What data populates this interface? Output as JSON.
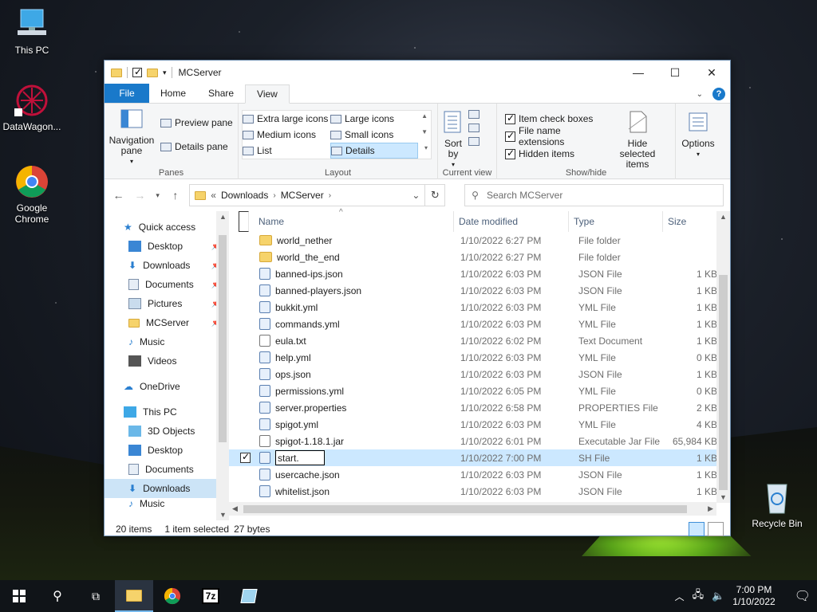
{
  "desktop": {
    "icons": [
      {
        "label": "This PC"
      },
      {
        "label": "DataWagon..."
      },
      {
        "label": "Google Chrome"
      },
      {
        "label": "Recycle Bin"
      }
    ]
  },
  "window": {
    "title": "MCServer",
    "menu_tabs": [
      "File",
      "Home",
      "Share",
      "View"
    ],
    "ribbon": {
      "panes": {
        "navigation_pane": "Navigation pane",
        "preview_pane": "Preview pane",
        "details_pane": "Details pane",
        "label": "Panes"
      },
      "layout": {
        "items": [
          "Extra large icons",
          "Large icons",
          "Medium icons",
          "Small icons",
          "List",
          "Details"
        ],
        "label": "Layout"
      },
      "current_view": {
        "sort_by": "Sort by",
        "label": "Current view"
      },
      "show_hide": {
        "item_check_boxes": "Item check boxes",
        "file_name_extensions": "File name extensions",
        "hidden_items": "Hidden items",
        "hide_selected_items": "Hide selected items",
        "label": "Show/hide"
      },
      "options": "Options"
    },
    "address": {
      "prefix": "«",
      "crumbs": [
        "Downloads",
        "MCServer"
      ],
      "search_placeholder": "Search MCServer"
    },
    "nav_pane": {
      "quick_access": "Quick access",
      "quick_items": [
        "Desktop",
        "Downloads",
        "Documents",
        "Pictures",
        "MCServer",
        "Music",
        "Videos"
      ],
      "onedrive": "OneDrive",
      "this_pc": "This PC",
      "pc_items": [
        "3D Objects",
        "Desktop",
        "Documents",
        "Downloads",
        "Music"
      ]
    },
    "columns": [
      "Name",
      "Date modified",
      "Type",
      "Size"
    ],
    "files": [
      {
        "name": "world_nether",
        "date": "1/10/2022 6:27 PM",
        "type": "File folder",
        "size": "",
        "icon": "folder-icon"
      },
      {
        "name": "world_the_end",
        "date": "1/10/2022 6:27 PM",
        "type": "File folder",
        "size": "",
        "icon": "folder-icon"
      },
      {
        "name": "banned-ips.json",
        "date": "1/10/2022 6:03 PM",
        "type": "JSON File",
        "size": "1 KB",
        "icon": "file-icon"
      },
      {
        "name": "banned-players.json",
        "date": "1/10/2022 6:03 PM",
        "type": "JSON File",
        "size": "1 KB",
        "icon": "file-icon"
      },
      {
        "name": "bukkit.yml",
        "date": "1/10/2022 6:03 PM",
        "type": "YML File",
        "size": "1 KB",
        "icon": "file-icon"
      },
      {
        "name": "commands.yml",
        "date": "1/10/2022 6:03 PM",
        "type": "YML File",
        "size": "1 KB",
        "icon": "file-icon"
      },
      {
        "name": "eula.txt",
        "date": "1/10/2022 6:02 PM",
        "type": "Text Document",
        "size": "1 KB",
        "icon": "text-file-icon"
      },
      {
        "name": "help.yml",
        "date": "1/10/2022 6:03 PM",
        "type": "YML File",
        "size": "0 KB",
        "icon": "file-icon"
      },
      {
        "name": "ops.json",
        "date": "1/10/2022 6:03 PM",
        "type": "JSON File",
        "size": "1 KB",
        "icon": "file-icon"
      },
      {
        "name": "permissions.yml",
        "date": "1/10/2022 6:05 PM",
        "type": "YML File",
        "size": "0 KB",
        "icon": "file-icon"
      },
      {
        "name": "server.properties",
        "date": "1/10/2022 6:58 PM",
        "type": "PROPERTIES File",
        "size": "2 KB",
        "icon": "file-icon"
      },
      {
        "name": "spigot.yml",
        "date": "1/10/2022 6:03 PM",
        "type": "YML File",
        "size": "4 KB",
        "icon": "file-icon"
      },
      {
        "name": "spigot-1.18.1.jar",
        "date": "1/10/2022 6:01 PM",
        "type": "Executable Jar File",
        "size": "65,984 KB",
        "icon": "jar-file-icon"
      },
      {
        "name": "start.",
        "date": "1/10/2022 7:00 PM",
        "type": "SH File",
        "size": "1 KB",
        "icon": "file-icon",
        "selected": true,
        "renaming": true
      },
      {
        "name": "usercache.json",
        "date": "1/10/2022 6:03 PM",
        "type": "JSON File",
        "size": "1 KB",
        "icon": "file-icon"
      },
      {
        "name": "whitelist.json",
        "date": "1/10/2022 6:03 PM",
        "type": "JSON File",
        "size": "1 KB",
        "icon": "file-icon"
      }
    ],
    "status": {
      "count": "20 items",
      "selected": "1 item selected",
      "size": "27 bytes"
    }
  },
  "taskbar": {
    "time": "7:00 PM",
    "date": "1/10/2022"
  },
  "colors": {
    "accent": "#1979ca",
    "selection": "#cce8ff",
    "taskbar": "#101418"
  }
}
